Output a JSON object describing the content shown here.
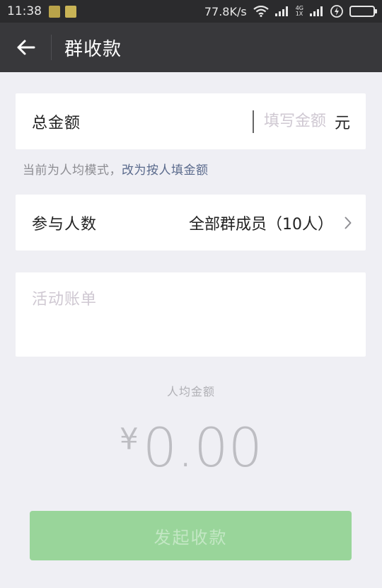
{
  "status_bar": {
    "time": "11:38",
    "speed": "77.8K/s",
    "network_label_top": "4G",
    "network_label_bottom": "1X",
    "icons": [
      "notification-app-icon",
      "notification-app-icon",
      "wifi-icon",
      "signal-icon",
      "signal-icon",
      "charging-icon",
      "battery-icon"
    ],
    "battery_color": "#33cc33"
  },
  "header": {
    "title": "群收款",
    "back_icon": "arrow-left-icon"
  },
  "amount": {
    "label": "总金额",
    "placeholder": "填写金额",
    "value": "",
    "unit": "元"
  },
  "hint": {
    "text": "当前为人均模式，",
    "link": "改为按人填金额"
  },
  "participants": {
    "label": "参与人数",
    "value": "全部群成员（10人）",
    "chevron_icon": "chevron-right-icon"
  },
  "note": {
    "placeholder": "活动账单",
    "value": ""
  },
  "average": {
    "label": "人均金额",
    "currency": "¥",
    "value": "0.00"
  },
  "submit": {
    "label": "发起收款",
    "color": "#99d59a"
  }
}
